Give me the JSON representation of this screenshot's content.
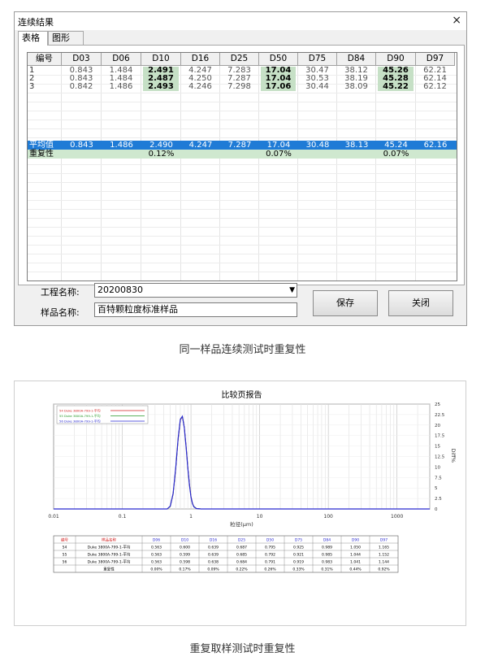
{
  "dialog": {
    "title": "连续结果",
    "close_glyph": "×",
    "tabs": [
      {
        "label": "表格"
      },
      {
        "label": "图形"
      }
    ],
    "columns": [
      "编号",
      "D03",
      "D06",
      "D10",
      "D16",
      "D25",
      "D50",
      "D75",
      "D84",
      "D90",
      "D97"
    ],
    "rows": [
      {
        "id": "1",
        "values": [
          "0.843",
          "1.484",
          "2.491",
          "4.247",
          "7.283",
          "17.04",
          "30.47",
          "38.12",
          "45.26",
          "62.21"
        ]
      },
      {
        "id": "2",
        "values": [
          "0.843",
          "1.484",
          "2.487",
          "4.250",
          "7.287",
          "17.04",
          "30.53",
          "38.19",
          "45.28",
          "62.14"
        ]
      },
      {
        "id": "3",
        "values": [
          "0.842",
          "1.486",
          "2.493",
          "4.246",
          "7.298",
          "17.06",
          "30.44",
          "38.09",
          "45.22",
          "62.12"
        ]
      }
    ],
    "average": {
      "label": "平均值",
      "values": [
        "0.843",
        "1.486",
        "2.490",
        "4.247",
        "7.287",
        "17.04",
        "30.48",
        "38.13",
        "45.24",
        "62.16"
      ]
    },
    "repeatability": {
      "label": "重复性",
      "values": [
        "",
        "",
        "0.12%",
        "",
        "",
        "0.07%",
        "",
        "",
        "0.07%",
        ""
      ]
    },
    "project_label": "工程名称:",
    "project_value": "20200830",
    "sample_label": "样品名称:",
    "sample_value": "百特颗粒度标准样品",
    "save_label": "保存",
    "close_label": "关闭"
  },
  "caption1": "同一样品连续测试时重复性",
  "report": {
    "title": "比较页报告",
    "legend": [
      {
        "label": "54  Duke 3800A-799-1-平均",
        "color": "#d22020"
      },
      {
        "label": "55  Duke 3800A-799-1-平均",
        "color": "#2a9a2a"
      },
      {
        "label": "56  Duke 3800A-799-1-平均",
        "color": "#2a2ad0"
      }
    ],
    "xlabel": "粒径(μm)",
    "ylabel": "Diff%",
    "xticks": [
      "0.01",
      "0.1",
      "1",
      "10",
      "100",
      "1000"
    ],
    "yticks": [
      "0",
      "2.5",
      "5",
      "7.5",
      "10",
      "12.5",
      "15",
      "17.5",
      "20",
      "22.5",
      "25"
    ],
    "table_headers": [
      "编号",
      "样品名称",
      "D06",
      "D10",
      "D16",
      "D25",
      "D50",
      "D75",
      "D84",
      "D90",
      "D97"
    ],
    "table_rows": [
      [
        "54",
        "Duke 3800A-799-1-平均",
        "0.563",
        "0.600",
        "0.639",
        "0.687",
        "0.795",
        "0.925",
        "0.989",
        "1.050",
        "1.165"
      ],
      [
        "55",
        "Duke 3800A-799-1-平均",
        "0.563",
        "0.599",
        "0.639",
        "0.685",
        "0.792",
        "0.921",
        "0.985",
        "1.044",
        "1.152"
      ],
      [
        "56",
        "Duke 3800A-799-1-平均",
        "0.563",
        "0.598",
        "0.638",
        "0.684",
        "0.791",
        "0.919",
        "0.983",
        "1.041",
        "1.144"
      ],
      [
        "",
        "重复性",
        "0.00%",
        "0.17%",
        "0.09%",
        "0.22%",
        "0.26%",
        "0.33%",
        "0.31%",
        "0.44%",
        "0.92%"
      ]
    ]
  },
  "caption2": "重复取样测试时重复性",
  "chart_data": {
    "type": "line",
    "title": "比较页报告",
    "xlabel": "粒径(μm)",
    "ylabel": "Diff%",
    "xscale": "log",
    "xlim": [
      0.01,
      3000
    ],
    "ylim": [
      0,
      25
    ],
    "grid": true,
    "legend_position": "top-left",
    "series": [
      {
        "name": "54  Duke 3800A-799-1-平均",
        "color": "#d22020",
        "x": [
          0.01,
          0.45,
          0.5,
          0.55,
          0.6,
          0.65,
          0.7,
          0.75,
          0.8,
          0.85,
          0.9,
          0.95,
          1.0,
          1.05,
          1.1,
          1.2,
          1.4,
          3000
        ],
        "y": [
          0,
          0,
          0.6,
          3.5,
          9.5,
          16.5,
          21.2,
          22.0,
          19.5,
          15.0,
          10.0,
          6.0,
          3.0,
          1.4,
          0.6,
          0.1,
          0,
          0
        ]
      },
      {
        "name": "55  Duke 3800A-799-1-平均",
        "color": "#2a9a2a",
        "x": [
          0.01,
          0.45,
          0.5,
          0.55,
          0.6,
          0.65,
          0.7,
          0.75,
          0.8,
          0.85,
          0.9,
          0.95,
          1.0,
          1.05,
          1.1,
          1.2,
          1.4,
          3000
        ],
        "y": [
          0,
          0,
          0.6,
          3.6,
          9.7,
          16.7,
          21.3,
          22.0,
          19.4,
          14.8,
          9.8,
          5.8,
          2.9,
          1.3,
          0.6,
          0.1,
          0,
          0
        ]
      },
      {
        "name": "56  Duke 3800A-799-1-平均",
        "color": "#2a2ad0",
        "x": [
          0.01,
          0.45,
          0.5,
          0.55,
          0.6,
          0.65,
          0.7,
          0.75,
          0.8,
          0.85,
          0.9,
          0.95,
          1.0,
          1.05,
          1.1,
          1.2,
          1.4,
          3000
        ],
        "y": [
          0,
          0,
          0.7,
          3.7,
          9.8,
          16.9,
          21.4,
          22.1,
          19.3,
          14.7,
          9.7,
          5.7,
          2.8,
          1.3,
          0.5,
          0.1,
          0,
          0
        ]
      }
    ]
  }
}
